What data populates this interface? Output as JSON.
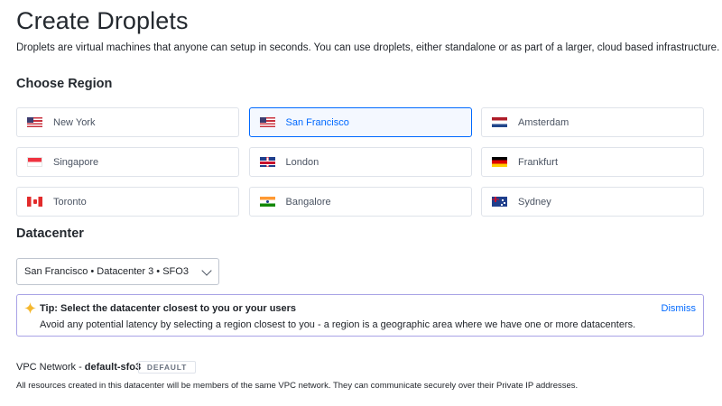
{
  "page": {
    "title": "Create Droplets",
    "description": "Droplets are virtual machines that anyone can setup in seconds. You can use droplets, either standalone or as part of a larger, cloud based infrastructure."
  },
  "region": {
    "section_title": "Choose Region",
    "selected": "San Francisco",
    "accent_color": "#0069ff",
    "options": [
      {
        "label": "New York",
        "flag": "us-flag-icon"
      },
      {
        "label": "San Francisco",
        "flag": "us-flag-icon"
      },
      {
        "label": "Amsterdam",
        "flag": "netherlands-flag-icon"
      },
      {
        "label": "Singapore",
        "flag": "singapore-flag-icon"
      },
      {
        "label": "London",
        "flag": "uk-flag-icon"
      },
      {
        "label": "Frankfurt",
        "flag": "germany-flag-icon"
      },
      {
        "label": "Toronto",
        "flag": "canada-flag-icon"
      },
      {
        "label": "Bangalore",
        "flag": "india-flag-icon"
      },
      {
        "label": "Sydney",
        "flag": "australia-flag-icon"
      }
    ]
  },
  "datacenter": {
    "section_title": "Datacenter",
    "selected_value": "San Francisco • Datacenter 3 • SFO3"
  },
  "tip": {
    "title": "Tip: Select the datacenter closest to you or your users",
    "body": "Avoid any potential latency by selecting a region closest to you - a region is a geographic area where we have one or more datacenters.",
    "dismiss_label": "Dismiss",
    "icon": "sparkle-icon",
    "border_color": "#a9a3e6"
  },
  "vpc": {
    "label_prefix": "VPC Network - ",
    "network_name": "default-sfo3",
    "badge": "DEFAULT",
    "description": "All resources created in this datacenter will be members of the same VPC network. They can communicate securely over their Private IP addresses."
  }
}
